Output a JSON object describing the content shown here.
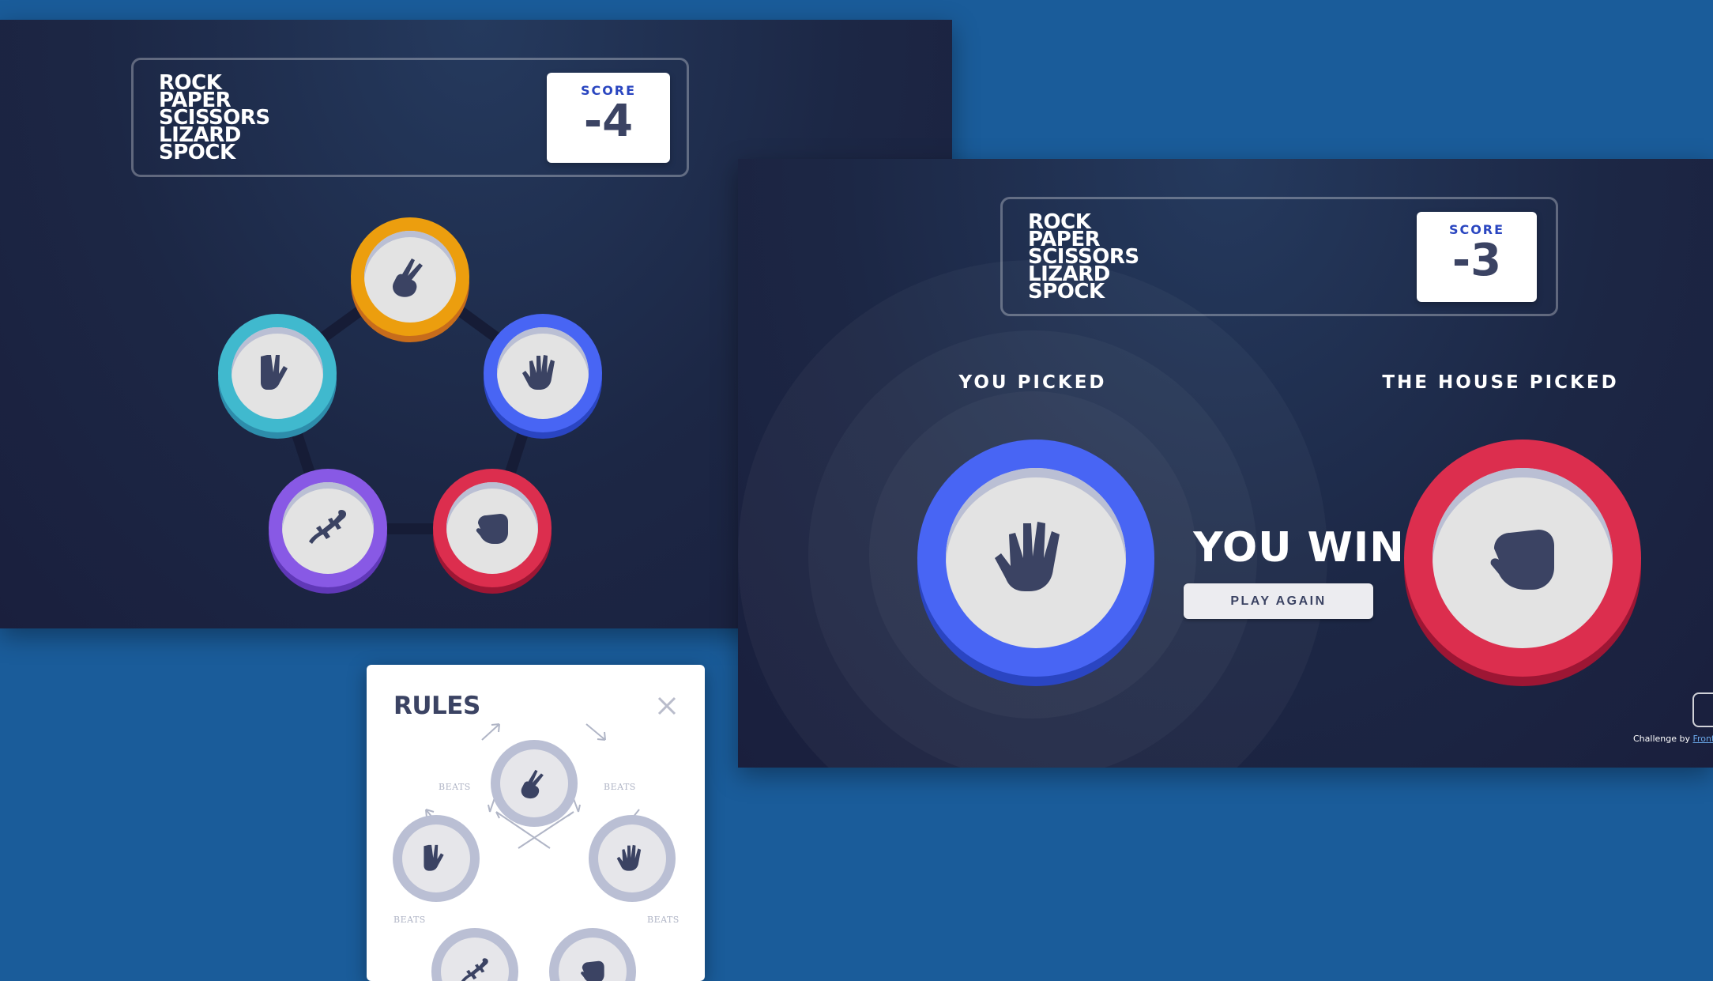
{
  "colors": {
    "page_bg": "#1a5c9a",
    "scissors": "#ec9e0e",
    "spock": "#40b9ce",
    "paper": "#4865f4",
    "lizard": "#8859e5",
    "rock": "#dc2e4e",
    "dark_text": "#3b4363",
    "score_label": "#2a46c0"
  },
  "panel_a": {
    "logo_lines": [
      "ROCK",
      "PAPER",
      "SCISSORS",
      "LIZARD",
      "SPOCK"
    ],
    "score_label": "SCORE",
    "score_value": "-4",
    "tokens": [
      {
        "name": "scissors",
        "icon": "scissors-icon"
      },
      {
        "name": "spock",
        "icon": "spock-icon"
      },
      {
        "name": "paper",
        "icon": "paper-icon"
      },
      {
        "name": "lizard",
        "icon": "lizard-icon"
      },
      {
        "name": "rock",
        "icon": "rock-icon"
      }
    ]
  },
  "panel_b": {
    "logo_lines": [
      "ROCK",
      "PAPER",
      "SCISSORS",
      "LIZARD",
      "SPOCK"
    ],
    "score_label": "SCORE",
    "score_value": "-3",
    "you_picked_label": "YOU PICKED",
    "house_picked_label": "THE HOUSE PICKED",
    "result_text": "YOU WIN",
    "play_again_label": "PLAY AGAIN",
    "player_choice": "paper",
    "house_choice": "rock",
    "attribution_prefix": "Challenge by ",
    "attribution_link": "Frontend M"
  },
  "rules_modal": {
    "title": "RULES",
    "beats_label": "BEATS",
    "close_icon": "close-icon"
  }
}
